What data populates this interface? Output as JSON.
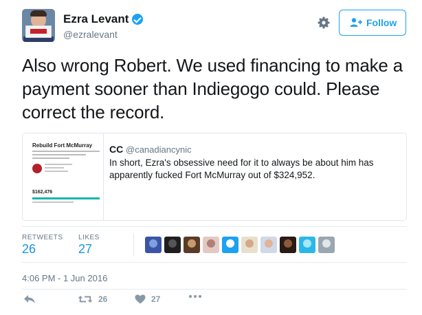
{
  "author": {
    "name": "Ezra Levant",
    "handle": "@ezralevant",
    "verified": true
  },
  "header": {
    "follow_label": "Follow",
    "settings_icon": "gear-icon"
  },
  "tweet": {
    "text": "Also wrong Robert. We used financing to make a payment sooner than Indiegogo could. Please correct the record."
  },
  "quoted_tweet": {
    "name": "CC",
    "handle": "@canadiancynic",
    "text": "In short, Ezra's obsessive need for it to always be about him has apparently fucked Fort McMurray out of $324,952.",
    "thumbnail": {
      "title": "Rebuild Fort McMurray",
      "amount": "$162,476"
    }
  },
  "stats": {
    "retweets_label": "RETWEETS",
    "retweets_value": "26",
    "likes_label": "LIKES",
    "likes_value": "27"
  },
  "likers": [
    {
      "bg": "#3a55a8",
      "fg": "#7ea0e0"
    },
    {
      "bg": "#1e1e1e",
      "fg": "#555555"
    },
    {
      "bg": "#5a3b28",
      "fg": "#c89a70"
    },
    {
      "bg": "#e3c9c3",
      "fg": "#b07f76"
    },
    {
      "bg": "#1da1f2",
      "fg": "#ffffff"
    },
    {
      "bg": "#e8e0cc",
      "fg": "#d4a98a"
    },
    {
      "bg": "#cfd9ea",
      "fg": "#e0b497"
    },
    {
      "bg": "#2a1a14",
      "fg": "#8a5a3a"
    },
    {
      "bg": "#29b8e8",
      "fg": "#a8e6f8"
    },
    {
      "bg": "#9aa6b0",
      "fg": "#e0e6ea"
    }
  ],
  "timestamp": "4:06 PM - 1 Jun 2016",
  "actions": {
    "retweet_count": "26",
    "like_count": "27"
  },
  "colors": {
    "accent": "#1da1f2",
    "link": "#1c94e0",
    "muted": "#657786"
  }
}
